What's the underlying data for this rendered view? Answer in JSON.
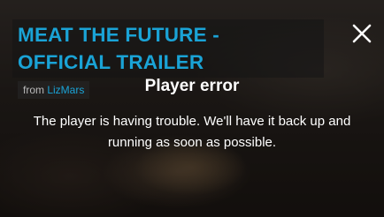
{
  "video": {
    "title": "MEAT THE FUTURE - OFFICIAL TRAILER",
    "from_label": "from",
    "author": "LizMars"
  },
  "error": {
    "title": "Player error",
    "message": "The player is having trouble. We'll have it back up and running as soon as possible."
  },
  "icons": {
    "close": "close-icon"
  },
  "colors": {
    "title_accent": "#1aa3d6",
    "error_text": "#ffffff"
  }
}
